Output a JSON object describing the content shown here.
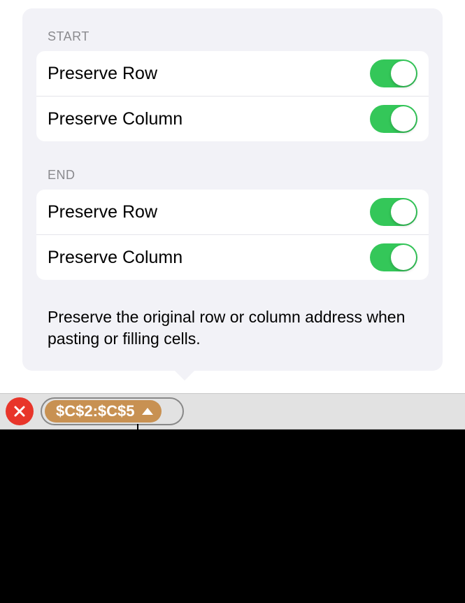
{
  "sections": {
    "start": {
      "header": "Start",
      "rows": [
        {
          "label": "Preserve Row",
          "enabled": true
        },
        {
          "label": "Preserve Column",
          "enabled": true
        }
      ]
    },
    "end": {
      "header": "End",
      "rows": [
        {
          "label": "Preserve Row",
          "enabled": true
        },
        {
          "label": "Preserve Column",
          "enabled": true
        }
      ]
    }
  },
  "description": "Preserve the original row or column address when pasting or filling cells.",
  "formula_bar": {
    "cell_reference": "$C$2:$C$5"
  }
}
